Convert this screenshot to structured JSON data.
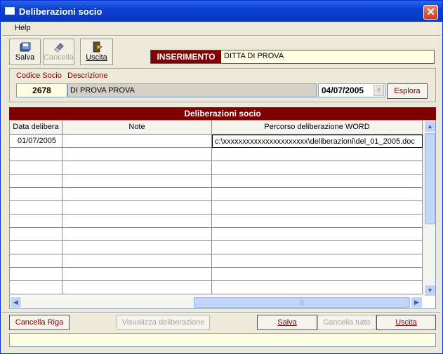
{
  "window": {
    "title": "Deliberazioni socio",
    "close": "✕"
  },
  "menu": {
    "help": "Help"
  },
  "toolbar": {
    "save": "Salva",
    "delete": "Cancella",
    "exit": "Uscita"
  },
  "mode": {
    "label": "INSERIMENTO",
    "value": "DITTA DI PROVA"
  },
  "member": {
    "code_label": "Codice Socio",
    "desc_label": "Descrizione",
    "code": "2678",
    "description": "DI PROVA PROVA",
    "date": "04/07/2005",
    "explore": "Esplora"
  },
  "grid": {
    "caption": "Deliberazioni socio",
    "columns": [
      "Data delibera",
      "Note",
      "Percorso deliberazione WORD"
    ],
    "rows": [
      [
        "01/07/2005",
        "",
        "c:\\xxxxxxxxxxxxxxxxxxxxxx\\deliberazioni\\del_01_2005.doc"
      ]
    ],
    "empty_rows": 11
  },
  "buttons": {
    "delete_row": "Cancella Riga",
    "view": "Visualizza deliberazione",
    "save": "Salva",
    "delete_all": "Cancella tutto",
    "exit": "Uscita"
  },
  "colors": {
    "accent": "#800000",
    "titlebar": "#0a3fd0",
    "highlight": "#fffde2"
  }
}
